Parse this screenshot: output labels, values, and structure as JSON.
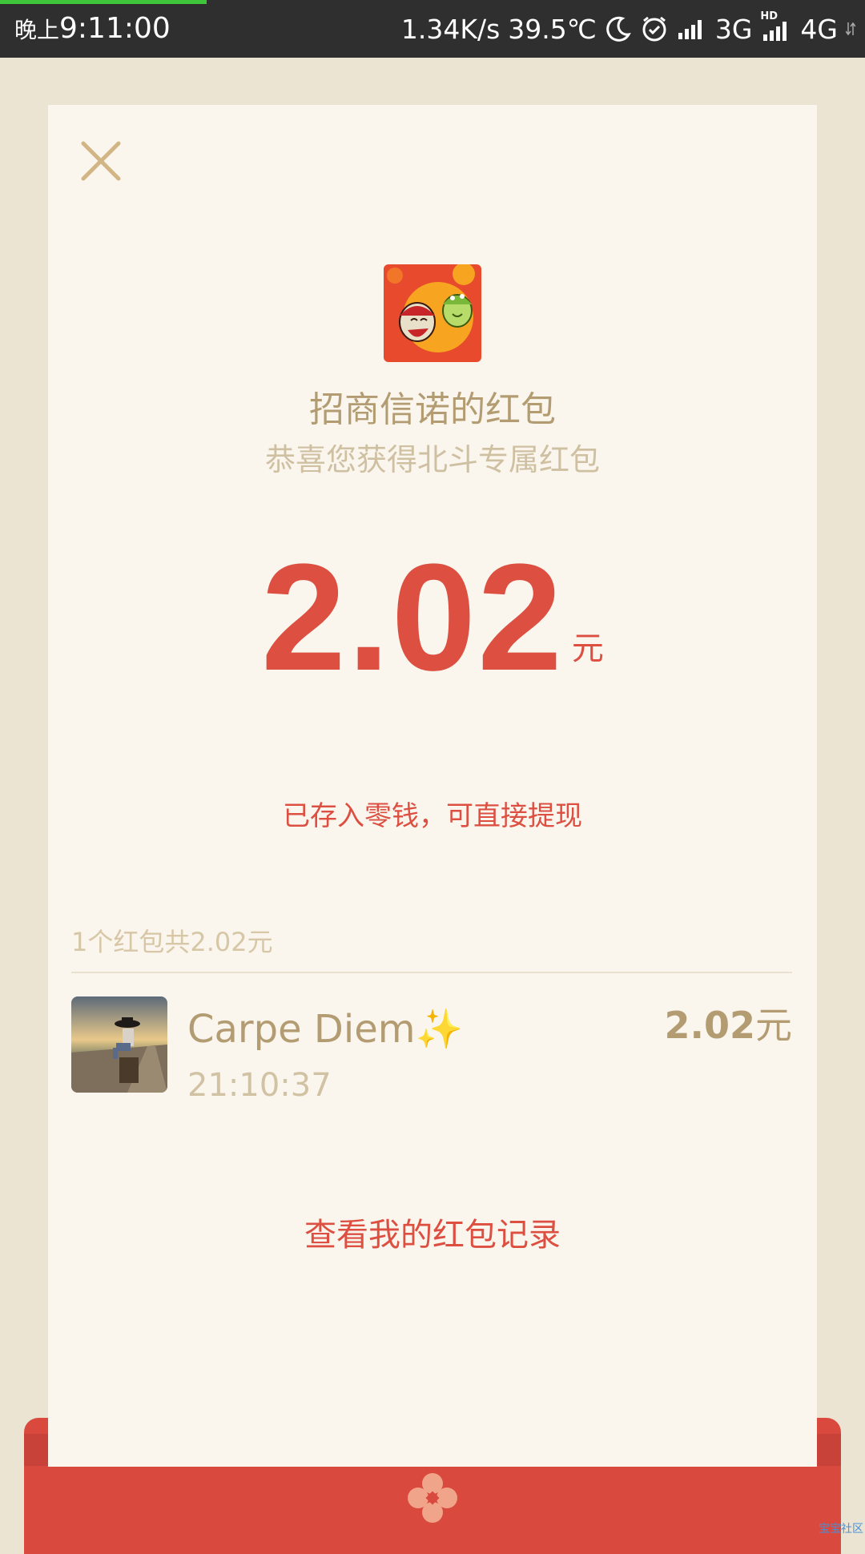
{
  "status_bar": {
    "ampm": "晚上",
    "time": "9:11:00",
    "net_speed": "1.34K/s",
    "temperature": "39.5℃",
    "net_3g": "3G",
    "hd": "HD",
    "net_4g": "4G",
    "icons": [
      "moon-icon",
      "alarm-icon",
      "signal-icon",
      "signal-hd-icon",
      "data-arrows-icon"
    ]
  },
  "card": {
    "sender_title": "招商信诺的红包",
    "greeting": "恭喜您获得北斗专属红包",
    "amount": "2.02",
    "amount_unit": "元",
    "deposit_note": "已存入零钱，可直接提现",
    "summary": "1个红包共2.02元",
    "records": [
      {
        "name": "Carpe Diem✨",
        "time": "21:10:37",
        "amount": "2.02",
        "unit": "元"
      }
    ],
    "history_link": "查看我的红包记录"
  },
  "colors": {
    "accent_red": "#dc4f41",
    "gold_text": "#b39c72",
    "card_bg": "#faf6ee",
    "page_bg": "#ece4d3",
    "envelope_red": "#d9493d"
  },
  "watermark": "宝宝社区"
}
